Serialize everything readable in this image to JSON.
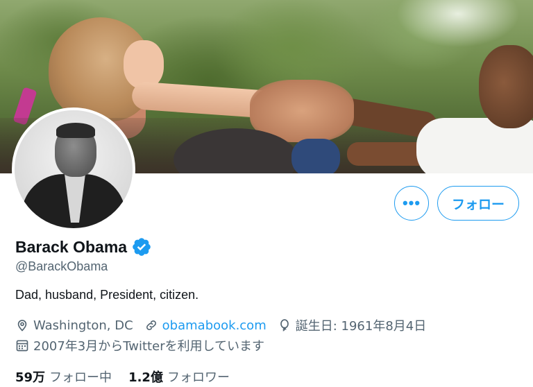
{
  "profile": {
    "display_name": "Barack Obama",
    "handle": "@BarackObama",
    "bio": "Dad, husband, President, citizen.",
    "location": "Washington, DC",
    "website": "obamabook.com",
    "birthday": "誕生日: 1961年8月4日",
    "joined": "2007年3月からTwitterを利用しています",
    "following_count": "59万",
    "following_label": "フォロー中",
    "followers_count": "1.2億",
    "followers_label": "フォロワー"
  },
  "actions": {
    "more_label": "•••",
    "follow_label": "フォロー"
  },
  "icons": {
    "verified": "verified-badge-icon",
    "location": "location-pin-icon",
    "link": "link-icon",
    "birthday": "balloon-icon",
    "calendar": "calendar-icon"
  },
  "colors": {
    "accent": "#1d9bf0",
    "text": "#0f1419",
    "secondary": "#536471"
  }
}
